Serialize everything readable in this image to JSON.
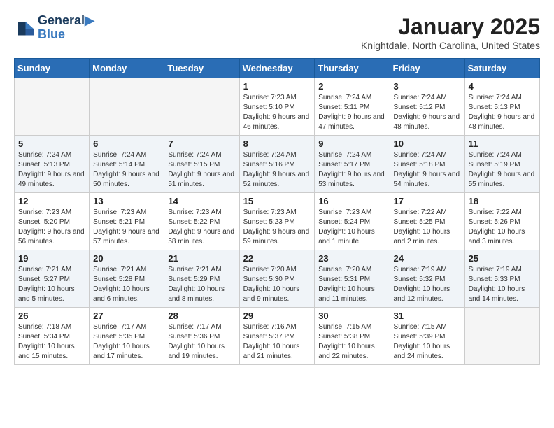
{
  "logo": {
    "line1": "General",
    "line2": "Blue"
  },
  "title": "January 2025",
  "subtitle": "Knightdale, North Carolina, United States",
  "weekdays": [
    "Sunday",
    "Monday",
    "Tuesday",
    "Wednesday",
    "Thursday",
    "Friday",
    "Saturday"
  ],
  "weeks": [
    [
      {
        "day": "",
        "empty": true
      },
      {
        "day": "",
        "empty": true
      },
      {
        "day": "",
        "empty": true
      },
      {
        "day": "1",
        "sunrise": "7:23 AM",
        "sunset": "5:10 PM",
        "daylight": "9 hours and 46 minutes."
      },
      {
        "day": "2",
        "sunrise": "7:24 AM",
        "sunset": "5:11 PM",
        "daylight": "9 hours and 47 minutes."
      },
      {
        "day": "3",
        "sunrise": "7:24 AM",
        "sunset": "5:12 PM",
        "daylight": "9 hours and 48 minutes."
      },
      {
        "day": "4",
        "sunrise": "7:24 AM",
        "sunset": "5:13 PM",
        "daylight": "9 hours and 48 minutes."
      }
    ],
    [
      {
        "day": "5",
        "sunrise": "7:24 AM",
        "sunset": "5:13 PM",
        "daylight": "9 hours and 49 minutes."
      },
      {
        "day": "6",
        "sunrise": "7:24 AM",
        "sunset": "5:14 PM",
        "daylight": "9 hours and 50 minutes."
      },
      {
        "day": "7",
        "sunrise": "7:24 AM",
        "sunset": "5:15 PM",
        "daylight": "9 hours and 51 minutes."
      },
      {
        "day": "8",
        "sunrise": "7:24 AM",
        "sunset": "5:16 PM",
        "daylight": "9 hours and 52 minutes."
      },
      {
        "day": "9",
        "sunrise": "7:24 AM",
        "sunset": "5:17 PM",
        "daylight": "9 hours and 53 minutes."
      },
      {
        "day": "10",
        "sunrise": "7:24 AM",
        "sunset": "5:18 PM",
        "daylight": "9 hours and 54 minutes."
      },
      {
        "day": "11",
        "sunrise": "7:24 AM",
        "sunset": "5:19 PM",
        "daylight": "9 hours and 55 minutes."
      }
    ],
    [
      {
        "day": "12",
        "sunrise": "7:23 AM",
        "sunset": "5:20 PM",
        "daylight": "9 hours and 56 minutes."
      },
      {
        "day": "13",
        "sunrise": "7:23 AM",
        "sunset": "5:21 PM",
        "daylight": "9 hours and 57 minutes."
      },
      {
        "day": "14",
        "sunrise": "7:23 AM",
        "sunset": "5:22 PM",
        "daylight": "9 hours and 58 minutes."
      },
      {
        "day": "15",
        "sunrise": "7:23 AM",
        "sunset": "5:23 PM",
        "daylight": "9 hours and 59 minutes."
      },
      {
        "day": "16",
        "sunrise": "7:23 AM",
        "sunset": "5:24 PM",
        "daylight": "10 hours and 1 minute."
      },
      {
        "day": "17",
        "sunrise": "7:22 AM",
        "sunset": "5:25 PM",
        "daylight": "10 hours and 2 minutes."
      },
      {
        "day": "18",
        "sunrise": "7:22 AM",
        "sunset": "5:26 PM",
        "daylight": "10 hours and 3 minutes."
      }
    ],
    [
      {
        "day": "19",
        "sunrise": "7:21 AM",
        "sunset": "5:27 PM",
        "daylight": "10 hours and 5 minutes."
      },
      {
        "day": "20",
        "sunrise": "7:21 AM",
        "sunset": "5:28 PM",
        "daylight": "10 hours and 6 minutes."
      },
      {
        "day": "21",
        "sunrise": "7:21 AM",
        "sunset": "5:29 PM",
        "daylight": "10 hours and 8 minutes."
      },
      {
        "day": "22",
        "sunrise": "7:20 AM",
        "sunset": "5:30 PM",
        "daylight": "10 hours and 9 minutes."
      },
      {
        "day": "23",
        "sunrise": "7:20 AM",
        "sunset": "5:31 PM",
        "daylight": "10 hours and 11 minutes."
      },
      {
        "day": "24",
        "sunrise": "7:19 AM",
        "sunset": "5:32 PM",
        "daylight": "10 hours and 12 minutes."
      },
      {
        "day": "25",
        "sunrise": "7:19 AM",
        "sunset": "5:33 PM",
        "daylight": "10 hours and 14 minutes."
      }
    ],
    [
      {
        "day": "26",
        "sunrise": "7:18 AM",
        "sunset": "5:34 PM",
        "daylight": "10 hours and 15 minutes."
      },
      {
        "day": "27",
        "sunrise": "7:17 AM",
        "sunset": "5:35 PM",
        "daylight": "10 hours and 17 minutes."
      },
      {
        "day": "28",
        "sunrise": "7:17 AM",
        "sunset": "5:36 PM",
        "daylight": "10 hours and 19 minutes."
      },
      {
        "day": "29",
        "sunrise": "7:16 AM",
        "sunset": "5:37 PM",
        "daylight": "10 hours and 21 minutes."
      },
      {
        "day": "30",
        "sunrise": "7:15 AM",
        "sunset": "5:38 PM",
        "daylight": "10 hours and 22 minutes."
      },
      {
        "day": "31",
        "sunrise": "7:15 AM",
        "sunset": "5:39 PM",
        "daylight": "10 hours and 24 minutes."
      },
      {
        "day": "",
        "empty": true
      }
    ]
  ]
}
